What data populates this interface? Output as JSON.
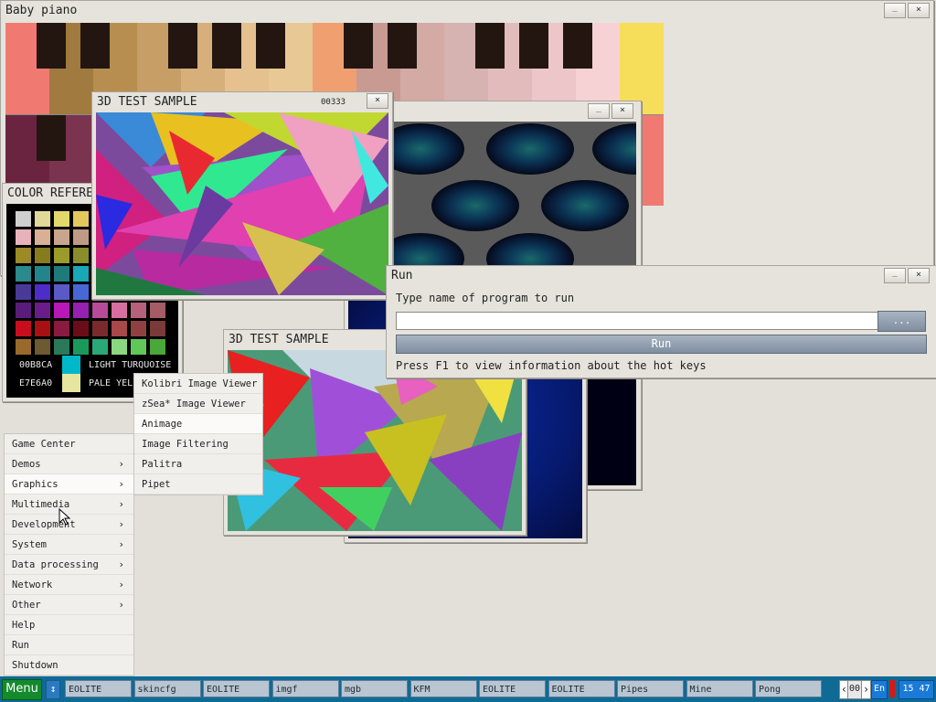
{
  "piano": {
    "title": "Baby piano",
    "min": "_",
    "close": "×"
  },
  "test3d_a": {
    "title": "3D TEST SAMPLE",
    "counter": "00333"
  },
  "pattern_window": {
    "min": "_",
    "close": "×"
  },
  "color_ref": {
    "title": "COLOR REFERE",
    "rows": [
      [
        "#cfcfcf",
        "#e1d89a",
        "#e2d96c",
        "#e3c85d",
        "#c9ad5a"
      ],
      [
        "#e8b2ba",
        "#d8b096",
        "#c8a58d",
        "#c09a86",
        "#a8806b"
      ],
      [
        "#9c8a24",
        "#867b1d",
        "#9b9b2a",
        "#8a8d2b",
        "#7d8c1c"
      ],
      [
        "#2b8a8c",
        "#23858b",
        "#1f7b7b",
        "#18a8b8",
        "#3e8fb8"
      ],
      [
        "#4a3a98",
        "#4e2cc8",
        "#5a5ac6",
        "#4768d4",
        "#3a6ab8"
      ],
      [
        "#5a1c7a",
        "#6a1d8a",
        "#b818b8",
        "#9620b0",
        "#b84a9a",
        "#d86ea0",
        "#b6607c",
        "#a55c64"
      ],
      [
        "#c80e1e",
        "#a81014",
        "#8a1a40",
        "#6a0d18",
        "#7a2a2a",
        "#a84848",
        "#904040",
        "#7a3a3a"
      ],
      [
        "#9a6a2a",
        "#6b5a32",
        "#2a7a5a",
        "#1a9a5a",
        "#2aa878",
        "#8ad880",
        "#60c858",
        "#4aa838"
      ]
    ],
    "entries": [
      {
        "hex": "00B8CA",
        "color": "#00b8ca",
        "name": "LIGHT TURQUOISE"
      },
      {
        "hex": "E7E6A0",
        "color": "#e7e6a0",
        "name": "PALE YEL"
      }
    ]
  },
  "run": {
    "title": "Run",
    "prompt": "Type name of program to run",
    "input_value": "",
    "browse_label": "...",
    "run_label": "Run",
    "hint": "Press F1 to view information about the hot keys",
    "min": "_",
    "close": "×"
  },
  "test3d_b": {
    "title": "3D TEST SAMPLE"
  },
  "main_menu": {
    "items": [
      {
        "label": "Game Center",
        "arrow": ""
      },
      {
        "label": "Demos",
        "arrow": "›"
      },
      {
        "label": "Graphics",
        "arrow": "›"
      },
      {
        "label": "Multimedia",
        "arrow": "›"
      },
      {
        "label": "Development",
        "arrow": "›"
      },
      {
        "label": "System",
        "arrow": "›"
      },
      {
        "label": "Data processing",
        "arrow": "›"
      },
      {
        "label": "Network",
        "arrow": "›"
      },
      {
        "label": "Other",
        "arrow": "›"
      },
      {
        "label": "Help",
        "arrow": ""
      },
      {
        "label": "Run",
        "arrow": ""
      },
      {
        "label": "Shutdown",
        "arrow": ""
      }
    ],
    "selected": "Graphics"
  },
  "graphics_submenu": {
    "items": [
      {
        "label": "Kolibri Image Viewer"
      },
      {
        "label": "zSea* Image Viewer"
      },
      {
        "label": "Animage"
      },
      {
        "label": "Image Filtering"
      },
      {
        "label": "Palitra"
      },
      {
        "label": "Pipet"
      }
    ],
    "selected": "Animage"
  },
  "taskbar": {
    "menu_label": "Menu",
    "switch_icon": "↕",
    "tasks": [
      "EOLITE",
      "skincfg",
      "EOLITE",
      "imgf",
      "mgb",
      "KFM",
      "EOLITE",
      "EOLITE",
      "Pipes",
      "Mine",
      "Pong"
    ],
    "counter": "00",
    "lang": "En",
    "clock": "15 47",
    "left_arrow": "‹",
    "right_arrow": "›",
    "accent": "#0f6a96",
    "menu_color": "#138a2c"
  }
}
